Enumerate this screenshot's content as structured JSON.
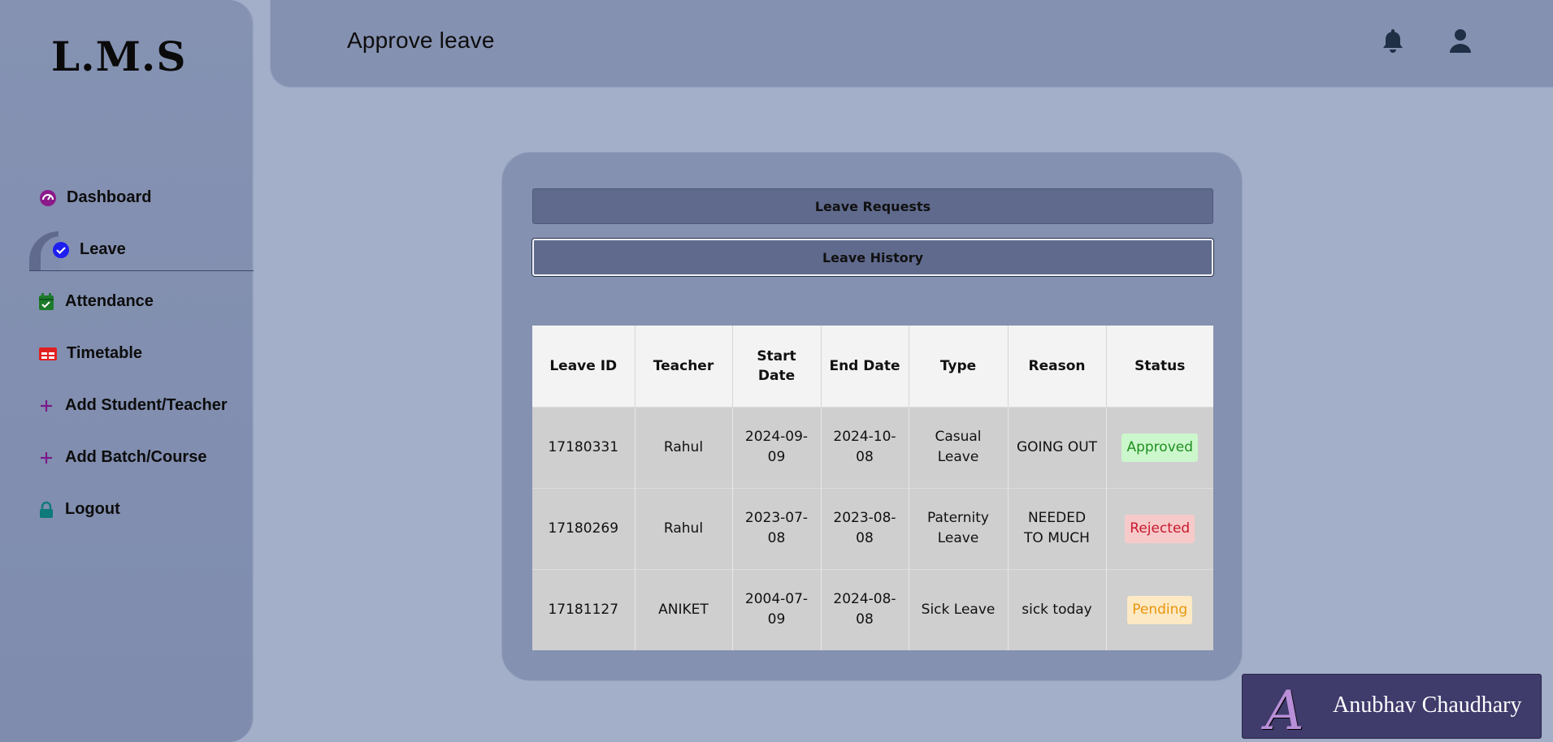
{
  "app": {
    "logo": "L.M.S"
  },
  "header": {
    "title": "Approve leave",
    "bell_icon": "bell-icon",
    "user_icon": "user-icon"
  },
  "sidebar": {
    "items": [
      {
        "label": "Dashboard",
        "icon": "dashboard-icon",
        "color": "#8b1a8b"
      },
      {
        "label": "Leave",
        "icon": "check-circle-icon",
        "color": "#1e1ef0",
        "active": true
      },
      {
        "label": "Attendance",
        "icon": "calendar-check-icon",
        "color": "#1d7a2a"
      },
      {
        "label": "Timetable",
        "icon": "table-icon",
        "color": "#e02020"
      },
      {
        "label": "Add Student/Teacher",
        "icon": "plus-icon",
        "color": "#7a1a8a"
      },
      {
        "label": "Add Batch/Course",
        "icon": "plus-icon",
        "color": "#7a1a8a"
      },
      {
        "label": "Logout",
        "icon": "lock-icon",
        "color": "#0f7a7a"
      }
    ]
  },
  "tabs": {
    "requests": "Leave Requests",
    "history": "Leave History",
    "active": "history"
  },
  "table": {
    "headers": [
      "Leave ID",
      "Teacher",
      "Start Date",
      "End Date",
      "Type",
      "Reason",
      "Status"
    ],
    "rows": [
      {
        "id": "17180331",
        "teacher": "Rahul",
        "start": "2024-09-09",
        "end": "2024-10-08",
        "type": "Casual Leave",
        "reason": "GOING OUT",
        "status": "Approved"
      },
      {
        "id": "17180269",
        "teacher": "Rahul",
        "start": "2023-07-08",
        "end": "2023-08-08",
        "type": "Paternity Leave",
        "reason": "NEEDED TO MUCH",
        "status": "Rejected"
      },
      {
        "id": "17181127",
        "teacher": "ANIKET",
        "start": "2004-07-09",
        "end": "2024-08-08",
        "type": "Sick Leave",
        "reason": "sick today",
        "status": "Pending"
      }
    ]
  },
  "watermark": {
    "mark": "A",
    "name": "Anubhav Chaudhary"
  }
}
